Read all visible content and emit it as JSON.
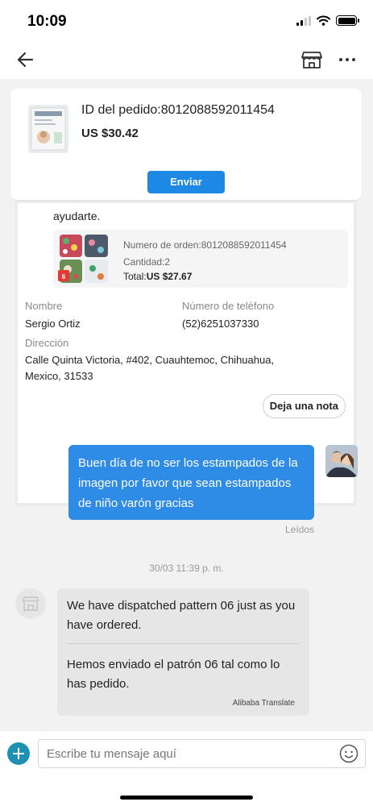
{
  "status_bar": {
    "time": "10:09"
  },
  "sticky_order": {
    "order_id_label": "ID del pedido:8012088592011454",
    "price": "US $30.42",
    "send_label": "Enviar"
  },
  "order_card": {
    "intro_text": "ayudarte.",
    "order_number": "Numero de orden:8012088592011454",
    "quantity": "Cantidad:2",
    "total_label": "Total:",
    "total_value": "US $27.67",
    "name_label": "Nombre",
    "name_value": "Sergio Ortiz",
    "phone_label": "Número de teléfono",
    "phone_value": "(52)6251037330",
    "address_label": "Dirección",
    "address_line1": "Calle Quinta Victoria, #402, Cuauhtemoc, Chihuahua,",
    "address_line2": "Mexico, 31533",
    "note_button": "Deja una nota"
  },
  "messages": {
    "outgoing_text": "Buen día de no ser los estampados de la imagen por favor que sean estampados de niño varón gracias",
    "read_status": "Leídos",
    "timestamp": "30/03 11:39 p. m.",
    "incoming_original": "We have dispatched pattern 06 just as you have ordered.",
    "incoming_translated": "Hemos enviado el patrón 06 tal como lo has pedido.",
    "translate_credit": "Alibaba Translate"
  },
  "input_bar": {
    "placeholder": "Escribe tu mensaje aquí"
  },
  "colors": {
    "accent": "#1e88e5",
    "bubble_out": "#2e8be6",
    "bubble_in": "#e6e6e6",
    "plus_button": "#1e90b4"
  },
  "icons": [
    "back-arrow-icon",
    "store-icon",
    "more-icon",
    "plus-icon",
    "emoji-icon"
  ]
}
